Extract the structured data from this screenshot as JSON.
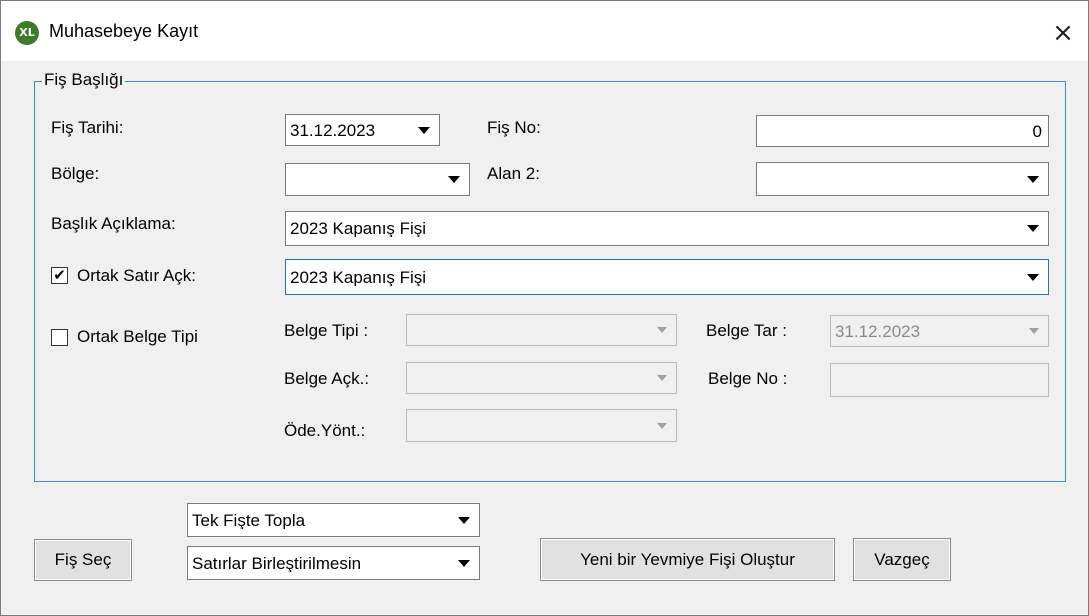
{
  "window": {
    "title": "Muhasebeye Kayıt",
    "app_icon": "XL"
  },
  "group": {
    "legend": "Fiş Başlığı",
    "fis_tarihi": {
      "label": "Fiş Tarihi:",
      "value": "31.12.2023"
    },
    "fis_no": {
      "label": "Fiş No:",
      "value": "0"
    },
    "bolge": {
      "label": "Bölge:",
      "value": ""
    },
    "alan2": {
      "label": "Alan 2:",
      "value": ""
    },
    "baslik_aciklama": {
      "label": "Başlık Açıklama:",
      "value": "2023 Kapanış Fişi"
    },
    "ortak_satir": {
      "label": "Ortak Satır Açk:",
      "checked": true,
      "check_glyph": "✔",
      "value": "2023 Kapanış Fişi"
    },
    "ortak_belge_tipi": {
      "label": "Ortak Belge Tipi",
      "checked": false
    },
    "belge_tipi": {
      "label": "Belge Tipi :",
      "value": ""
    },
    "belge_tar": {
      "label": "Belge Tar :",
      "value": "31.12.2023"
    },
    "belge_ack": {
      "label": "Belge Açk.:",
      "value": ""
    },
    "belge_no": {
      "label": "Belge No :",
      "value": ""
    },
    "ode_yont": {
      "label": "Öde.Yönt.:",
      "value": ""
    }
  },
  "bottom": {
    "combo1": "Tek Fişte Topla",
    "combo2": "Satırlar Birleştirilmesin",
    "fis_sec": "Fiş Seç",
    "yeni_fis": "Yeni bir Yevmiye Fişi Oluştur",
    "vazgec": "Vazgeç"
  },
  "icons": {
    "close": "×",
    "dropdown": "chevron-down"
  },
  "colors": {
    "group_border": "#3c8fd6",
    "focus_border": "#2d6fbf",
    "icon_green": "#3d7a2c"
  }
}
